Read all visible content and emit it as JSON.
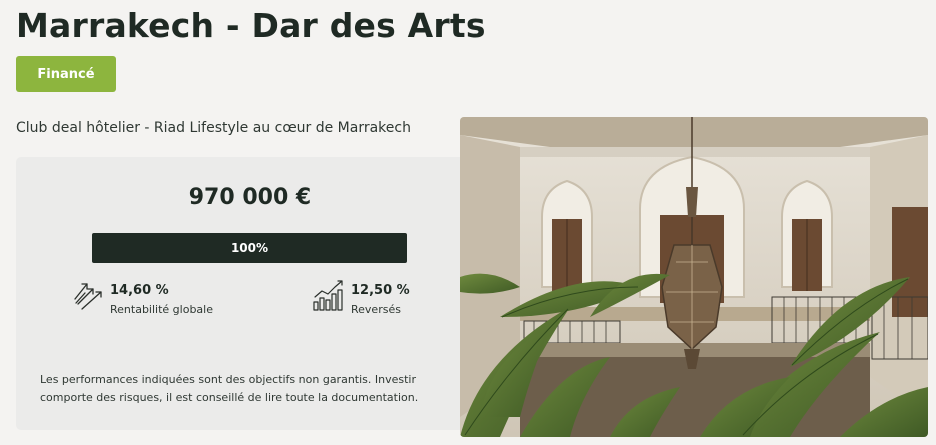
{
  "header": {
    "title": "Marrakech - Dar des Arts",
    "status": "Financé"
  },
  "summary": {
    "subtitle": "Club deal hôtelier - Riad Lifestyle au cœur de Marrakech",
    "amount": "970 000 €",
    "progress": {
      "value": 1.0,
      "label": "100%"
    },
    "stats": [
      {
        "value": "14,60 %",
        "label": "Rentabilité globale",
        "icon": "growth-arrows-icon"
      },
      {
        "value": "12,50 %",
        "label": "Reversés",
        "icon": "bar-chart-trend-icon"
      }
    ],
    "disclaimer": "Les performances indiquées sont des objectifs non garantis. Investir comporte des risques, il est conseillé de lire toute la documentation."
  },
  "colors": {
    "accent_green": "#8db53e",
    "dark": "#1f2a24",
    "card_bg": "#ebebea",
    "page_bg": "#f4f3f1"
  },
  "photo": {
    "icon": "riad-courtyard-photo"
  }
}
